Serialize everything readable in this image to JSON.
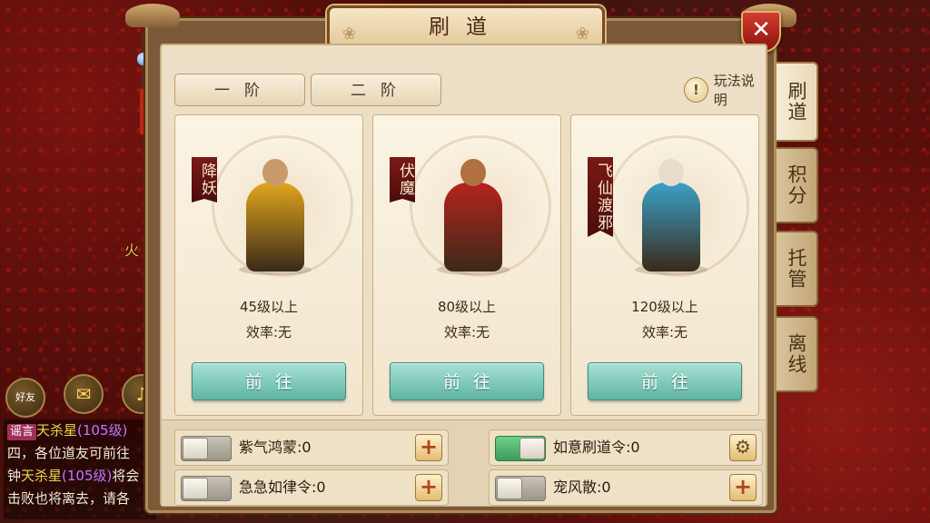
{
  "window": {
    "title": "刷道",
    "close_icon": "close-icon"
  },
  "stage_tabs": [
    {
      "label": "一阶"
    },
    {
      "label": "二阶"
    }
  ],
  "help": {
    "label": "玩法说明",
    "icon": "exclamation-icon"
  },
  "cards": [
    {
      "banner": "降妖",
      "level": "45级以上",
      "efficiency": "效率:无",
      "button": "前往",
      "robe_color": "#e1a51c",
      "head_color": "#c99a6a"
    },
    {
      "banner": "伏魔",
      "level": "80级以上",
      "efficiency": "效率:无",
      "button": "前往",
      "robe_color": "#b6231c",
      "head_color": "#b07040"
    },
    {
      "banner": "飞仙渡邪",
      "level": "120级以上",
      "efficiency": "效率:无",
      "button": "前往",
      "robe_color": "#3aa0c8",
      "head_color": "#e8dccc"
    }
  ],
  "items": [
    {
      "label": "紫气鸿蒙:0",
      "toggle": "off",
      "action_icon": "plus-icon",
      "action_glyph": "+"
    },
    {
      "label": "如意刷道令:0",
      "toggle": "on",
      "action_icon": "gear-icon",
      "action_glyph": "⚙"
    },
    {
      "label": "急急如律令:0",
      "toggle": "off",
      "action_icon": "plus-icon",
      "action_glyph": "+"
    },
    {
      "label": "宠风散:0",
      "toggle": "off",
      "action_icon": "plus-icon",
      "action_glyph": "+"
    }
  ],
  "side_tabs": [
    {
      "label": "刷道",
      "active": true
    },
    {
      "label": "积分",
      "active": false
    },
    {
      "label": "托管",
      "active": false
    },
    {
      "label": "离线",
      "active": false
    }
  ],
  "background": {
    "fire_text": "火",
    "chat_tab": "好友",
    "chat_lines": [
      {
        "tag": "谣言",
        "name": "天杀星",
        "level": "(105级)",
        "rest": ""
      },
      {
        "text": "四，各位道友可前往"
      },
      {
        "prefix": "钟",
        "name": "天杀星",
        "level": "(105级)",
        "rest": "将会"
      },
      {
        "text": "击败也将离去，请各"
      }
    ]
  }
}
